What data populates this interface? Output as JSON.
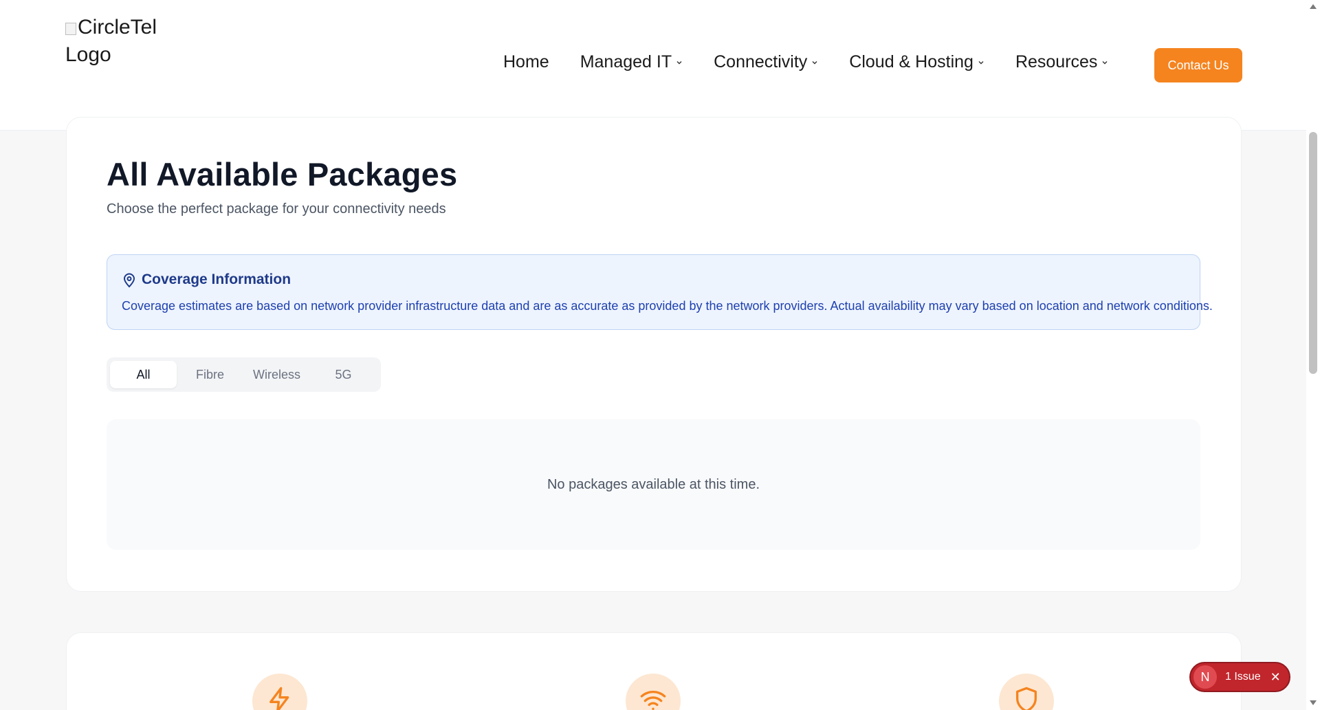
{
  "header": {
    "logo_alt": "CircleTel Logo",
    "nav": [
      {
        "label": "Home",
        "dropdown": false
      },
      {
        "label": "Managed IT",
        "dropdown": true
      },
      {
        "label": "Connectivity",
        "dropdown": true
      },
      {
        "label": "Cloud & Hosting",
        "dropdown": true
      },
      {
        "label": "Resources",
        "dropdown": true
      }
    ],
    "contact_label": "Contact Us"
  },
  "main": {
    "title": "All Available Packages",
    "subtitle": "Choose the perfect package for your connectivity needs",
    "coverage": {
      "icon": "map-pin-icon",
      "title": "Coverage Information",
      "text": "Coverage estimates are based on network provider infrastructure data and are as accurate as provided by the network providers. Actual availability may vary based on location and network conditions."
    },
    "tabs": [
      {
        "label": "All",
        "active": true
      },
      {
        "label": "Fibre",
        "active": false
      },
      {
        "label": "Wireless",
        "active": false
      },
      {
        "label": "5G",
        "active": false
      }
    ],
    "empty_message": "No packages available at this time."
  },
  "features": {
    "icons": [
      "zap-icon",
      "wifi-icon",
      "shield-icon"
    ]
  },
  "issue_badge": {
    "avatar_letter": "N",
    "label": "1 Issue"
  },
  "colors": {
    "accent": "#f5841f",
    "coverage_bg": "#eef4fe",
    "coverage_text": "#1e40af",
    "issue_bg": "#c1262c"
  }
}
